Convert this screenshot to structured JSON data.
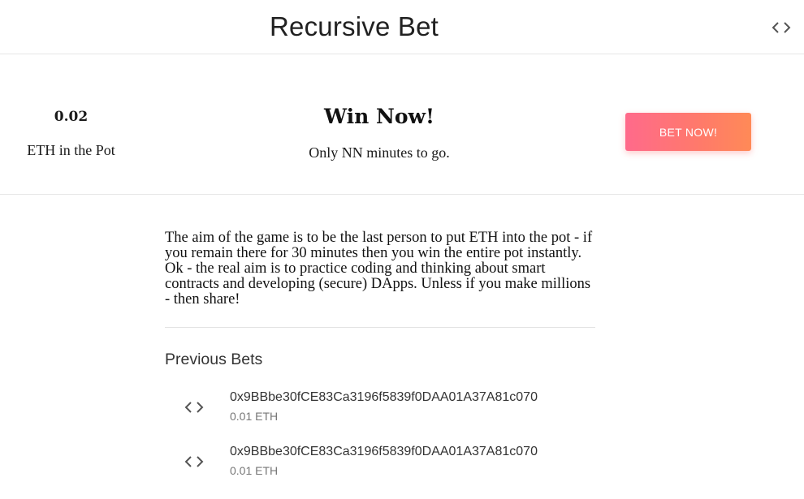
{
  "header": {
    "title": "Recursive Bet",
    "icon": "code-icon"
  },
  "hero": {
    "pot_amount": "0.02",
    "pot_label": "ETH in the Pot",
    "win_title": "Win Now!",
    "win_subtitle": "Only NN minutes to go.",
    "bet_button_label": "BET NOW!",
    "bet_button_gradient": [
      "#ff6a8b",
      "#ff8a57"
    ]
  },
  "description": "The aim of the game is to be the last person to put ETH into the pot - if you remain there for 30 minutes then you win the entire pot instantly. Ok - the real aim is to practice coding and thinking about smart contracts and developing (secure) DApps. Unless if you make millions - then share!",
  "previous_bets": {
    "heading": "Previous Bets",
    "items": [
      {
        "icon": "code-icon",
        "address": "0x9BBbe30fCE83Ca3196f5839f0DAA01A37A81c070",
        "amount": "0.01 ETH"
      },
      {
        "icon": "code-icon",
        "address": "0x9BBbe30fCE83Ca3196f5839f0DAA01A37A81c070",
        "amount": "0.01 ETH"
      }
    ]
  }
}
